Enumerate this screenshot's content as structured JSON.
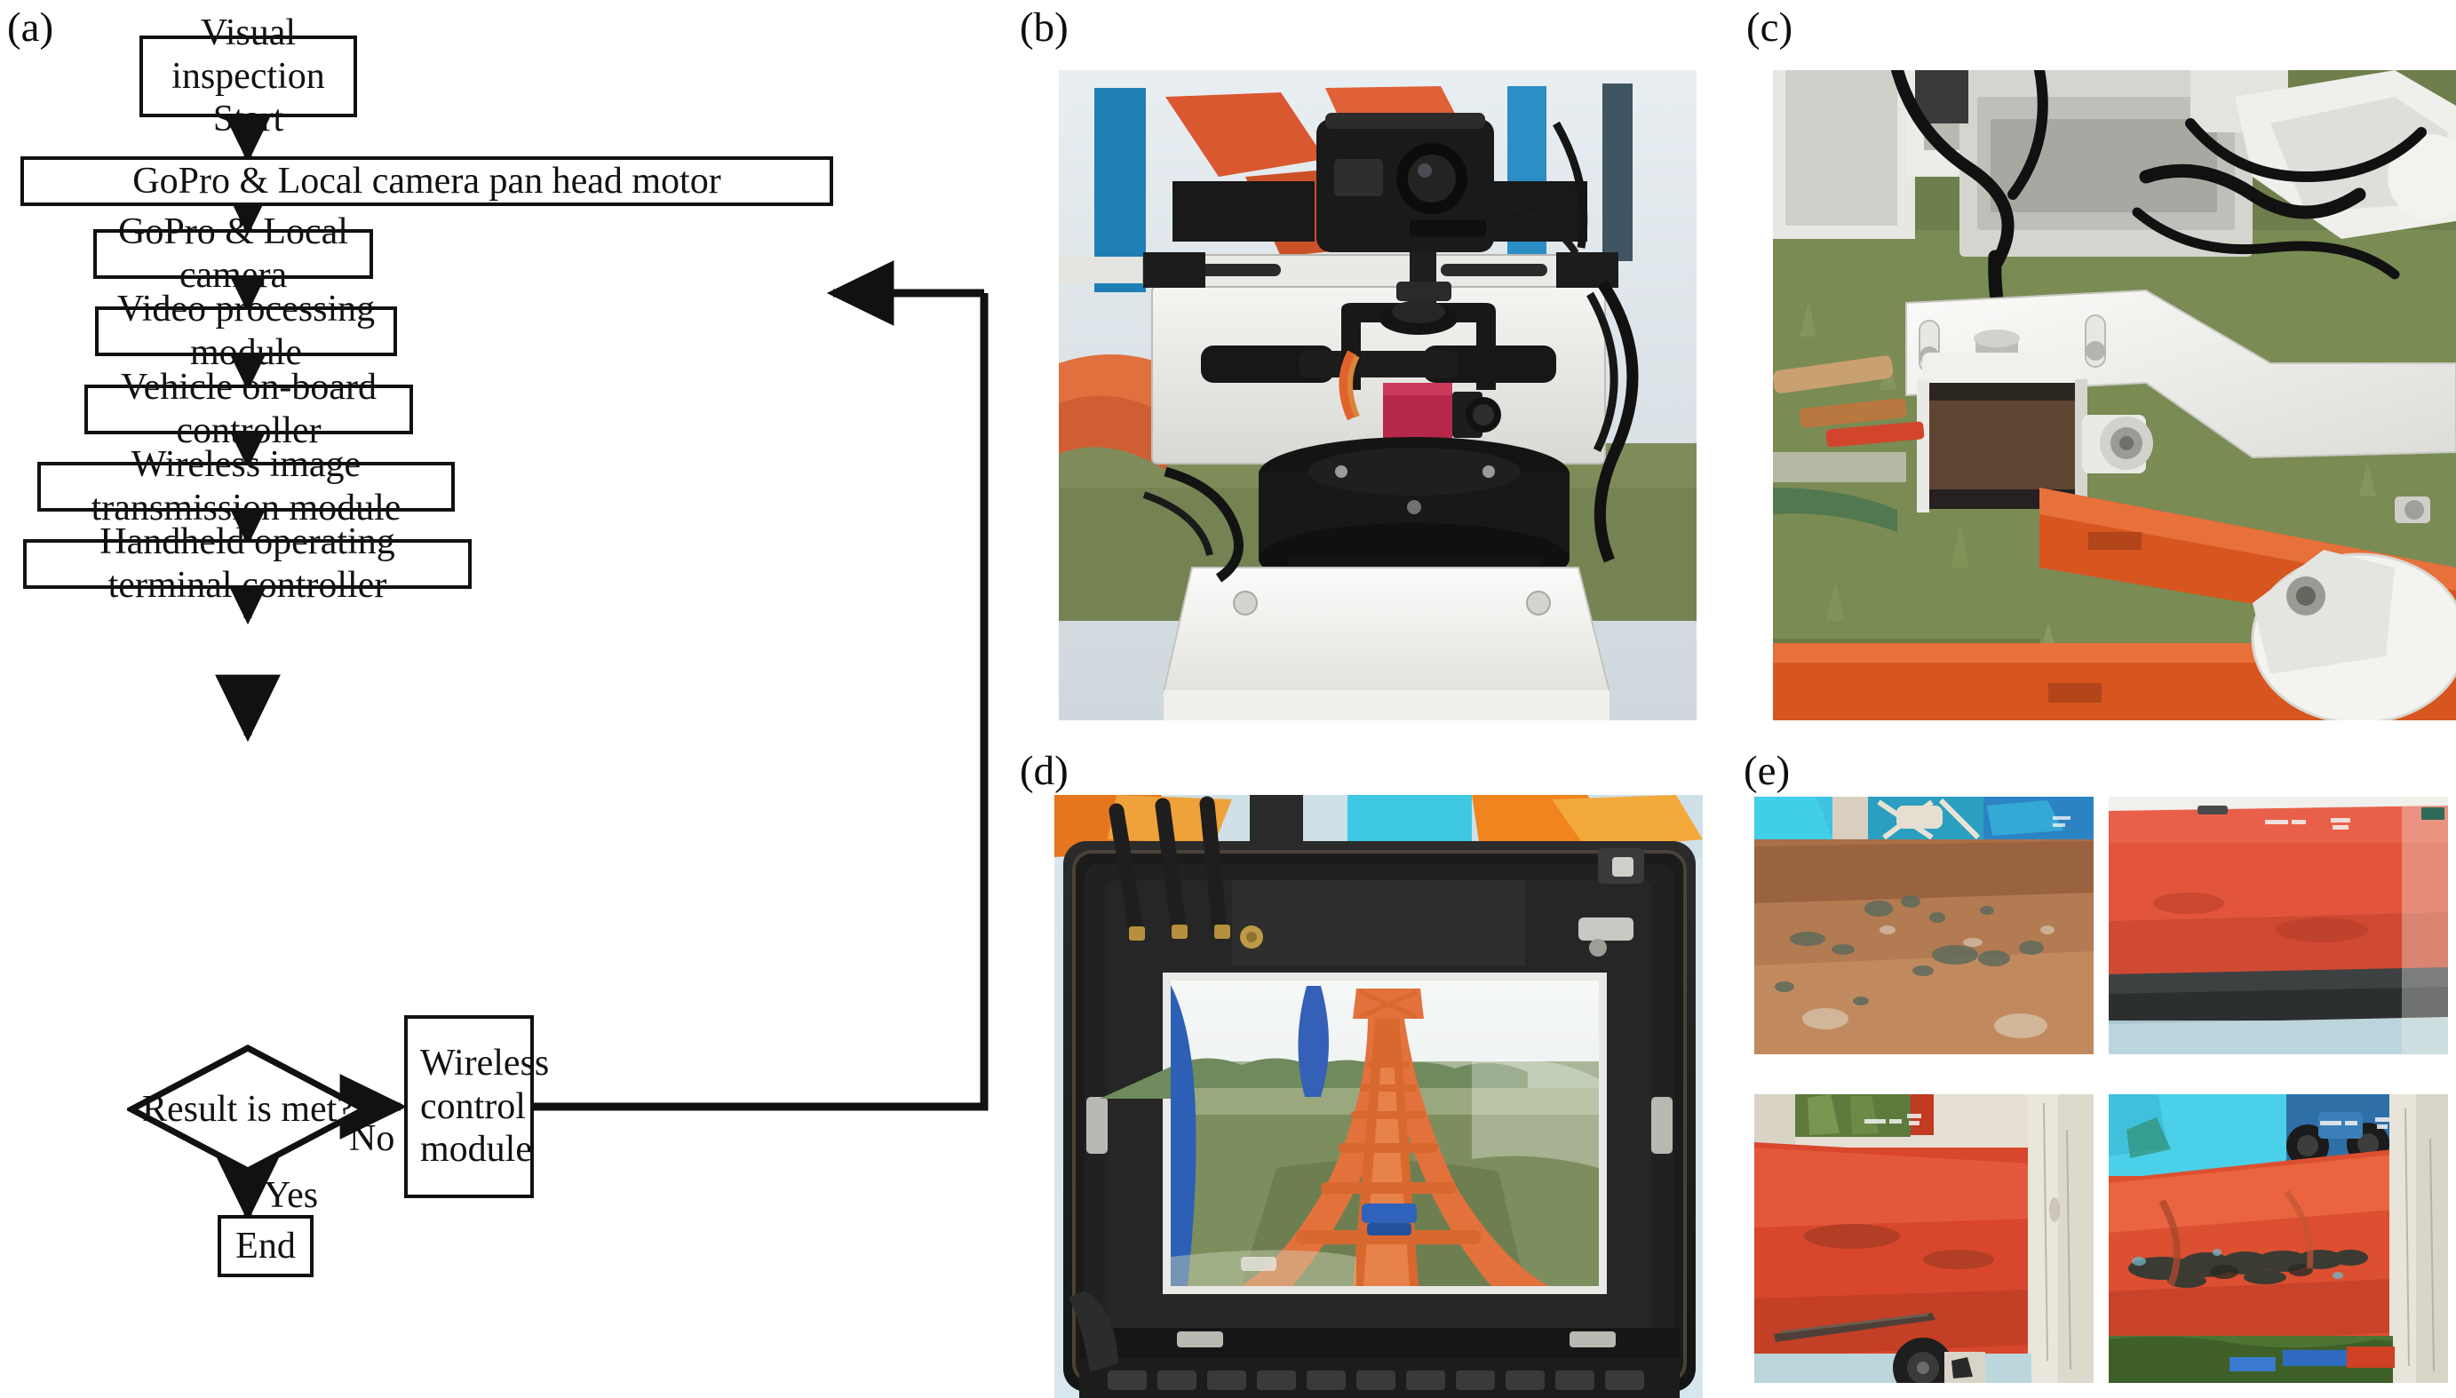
{
  "figure": {
    "panels": [
      {
        "id": "a",
        "letter": "(a)",
        "kind": "flowchart"
      },
      {
        "id": "b",
        "letter": "(b)",
        "kind": "photograph",
        "caption_text": ""
      },
      {
        "id": "c",
        "letter": "(c)",
        "kind": "photograph",
        "caption_text": ""
      },
      {
        "id": "d",
        "letter": "(d)",
        "kind": "photograph",
        "caption_text": ""
      },
      {
        "id": "e",
        "letter": "(e)",
        "kind": "photograph",
        "caption_text": ""
      }
    ]
  },
  "flowchart": {
    "nodes": [
      {
        "id": "start",
        "label": "Visual inspection\nStart",
        "shape": "rect"
      },
      {
        "id": "panhead",
        "label": "GoPro & Local camera pan head motor",
        "shape": "rect"
      },
      {
        "id": "cameras",
        "label": "GoPro & Local camera",
        "shape": "rect"
      },
      {
        "id": "video",
        "label": "Video processing module",
        "shape": "rect"
      },
      {
        "id": "onboard",
        "label": "Vehicle on-board controller",
        "shape": "rect"
      },
      {
        "id": "wireless_tx",
        "label": "Wireless image transmission module",
        "shape": "rect"
      },
      {
        "id": "handheld",
        "label": "Handheld operating terminal controller",
        "shape": "rect"
      },
      {
        "id": "decision",
        "label": "Result is met?",
        "shape": "diamond"
      },
      {
        "id": "wctrl",
        "label": "Wireless\ncontrol\nmodule",
        "shape": "rect"
      },
      {
        "id": "end",
        "label": "End",
        "shape": "rect"
      }
    ],
    "edge_labels": {
      "yes": "Yes",
      "no": "No"
    },
    "stroke_color": "#111111"
  },
  "photos": {
    "b": {
      "subject": "GoPro camera and local camera mounted on pan head motor",
      "sub_images": 1
    },
    "c": {
      "subject": "Local camera on white mounting bracket over track beam",
      "sub_images": 1
    },
    "d": {
      "subject": "Handheld operating terminal showing live track video",
      "sub_images": 1
    },
    "e": {
      "subject": "Four inspection video frames of roller coaster track",
      "sub_images": 4
    }
  }
}
